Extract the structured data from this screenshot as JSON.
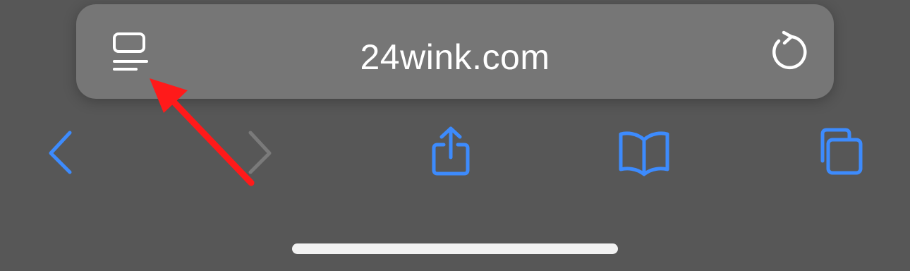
{
  "address_bar": {
    "url": "24wink.com",
    "reader_icon": "page-menu-icon",
    "reload_icon": "reload-icon"
  },
  "toolbar": {
    "back_icon": "chevron-left-icon",
    "forward_icon": "chevron-right-icon",
    "share_icon": "share-icon",
    "bookmarks_icon": "book-icon",
    "tabs_icon": "tabs-icon"
  },
  "colors": {
    "background": "#575757",
    "address_bar": "#767676",
    "accent": "#3d8bfd",
    "disabled": "#7a7a7a",
    "annotation_arrow": "#ff1a1a"
  }
}
